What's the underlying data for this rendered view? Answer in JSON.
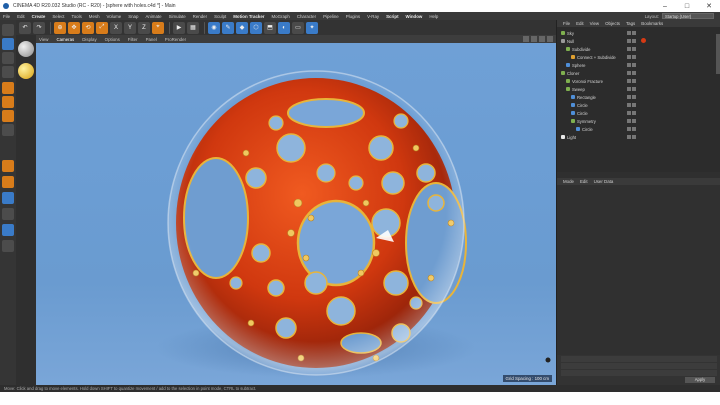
{
  "window": {
    "title": "CINEMA 4D R20.032 Studio (RC - R20) - [sphere with holes.c4d *] - Main",
    "minimize_glyph": "–",
    "maximize_glyph": "□",
    "close_glyph": "✕"
  },
  "menu": {
    "items": [
      "File",
      "Edit",
      "Create",
      "Select",
      "Tools",
      "Mesh",
      "Volume",
      "Snap",
      "Animate",
      "Simulate",
      "Render",
      "Sculpt",
      "Motion Tracker",
      "MoGraph",
      "Character",
      "Pipeline",
      "Plugins",
      "V-Ray",
      "Script",
      "Window",
      "Help"
    ],
    "layout_label": "Layout:",
    "layout_value": "Startup (User)"
  },
  "toolbar": {
    "buttons": [
      "↶",
      "↷",
      "⊕",
      "✥",
      "⟲",
      "⤢",
      "X",
      "Y",
      "Z",
      "⌖",
      "▶",
      "▦",
      "◉",
      "✎",
      "◆",
      "⬡",
      "⬒",
      "◐",
      "▭",
      "✦"
    ]
  },
  "viewport": {
    "menu": [
      "View",
      "Cameras",
      "Display",
      "Options",
      "Filter",
      "Panel",
      "ProRender"
    ],
    "grid_spacing": "Grid Spacing : 100 cm"
  },
  "object_manager": {
    "tabs": [
      "File",
      "Edit",
      "View",
      "Objects",
      "Tags",
      "Bookmarks"
    ],
    "objects": [
      {
        "name": "Sky",
        "indent": 0,
        "color": "#7fb04f"
      },
      {
        "name": "Null",
        "indent": 0,
        "color": "#9a9a9a"
      },
      {
        "name": "Subdivide",
        "indent": 1,
        "color": "#7fb04f"
      },
      {
        "name": "Connect + Subdivide",
        "indent": 2,
        "color": "#e0a030"
      },
      {
        "name": "Sphere",
        "indent": 1,
        "color": "#4f8fd8"
      },
      {
        "name": "Cloner",
        "indent": 0,
        "color": "#7fb04f"
      },
      {
        "name": "Voronoi Fracture",
        "indent": 1,
        "color": "#7fb04f"
      },
      {
        "name": "Sweep",
        "indent": 1,
        "color": "#7fb04f"
      },
      {
        "name": "Rectangle",
        "indent": 2,
        "color": "#4f8fd8"
      },
      {
        "name": "Circle",
        "indent": 2,
        "color": "#4f8fd8"
      },
      {
        "name": "Circle",
        "indent": 2,
        "color": "#4f8fd8"
      },
      {
        "name": "Symmetry",
        "indent": 2,
        "color": "#7fb04f"
      },
      {
        "name": "Circle",
        "indent": 3,
        "color": "#4f8fd8"
      },
      {
        "name": "Light",
        "indent": 0,
        "color": "#e8e8e8"
      }
    ]
  },
  "attributes": {
    "tabs": [
      "Mode",
      "Edit",
      "User Data"
    ],
    "apply_label": "Apply"
  },
  "status": {
    "text": "Move: Click and drag to move elements. Hold down SHIFT to quantize movement / add to the selection in point mode, CTRL to subtract."
  },
  "colors": {
    "viewport_bg": "#6b9dd3",
    "accent": "#3a7bc8",
    "object_red": "#d63a14",
    "object_gold": "#e8b43a"
  }
}
